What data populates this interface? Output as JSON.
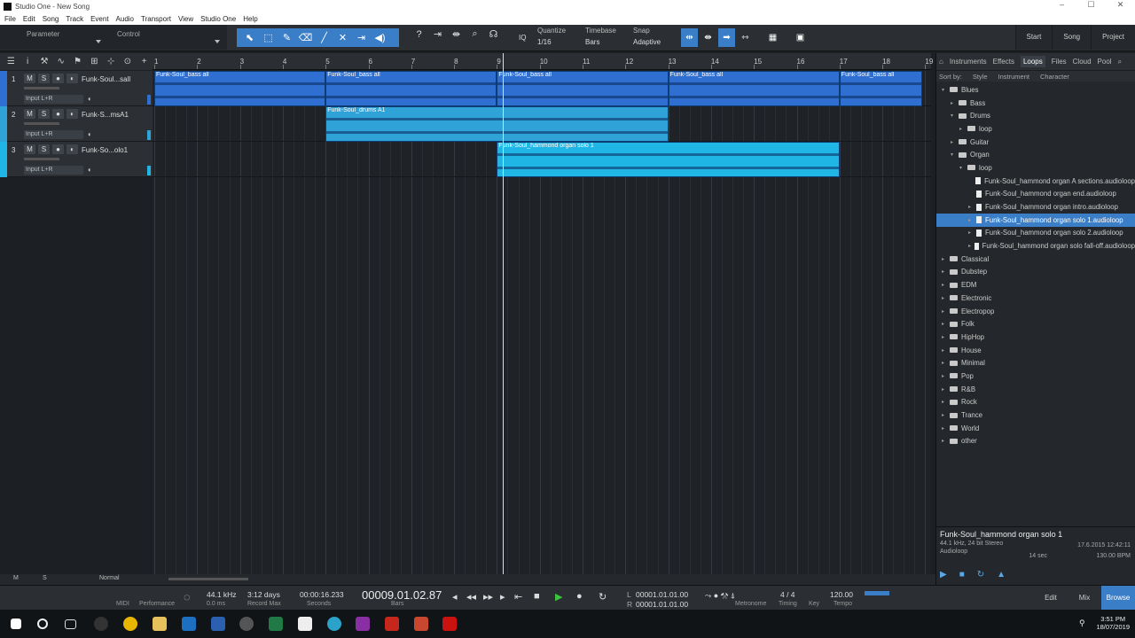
{
  "window": {
    "title": "Studio One - New Song",
    "controls": [
      "–",
      "☐",
      "✕"
    ]
  },
  "menu": [
    "File",
    "Edit",
    "Song",
    "Track",
    "Event",
    "Audio",
    "Transport",
    "View",
    "Studio One",
    "Help"
  ],
  "toolbar": {
    "parameter_label": "Parameter",
    "control_label": "Control",
    "quantize_label": "Quantize",
    "quantize_value": "1/16",
    "timebase_label": "Timebase",
    "timebase_value": "Bars",
    "snap_label": "Snap",
    "snap_value": "Adaptive",
    "iq_label": "IQ",
    "nav": [
      "Start",
      "Song",
      "Project"
    ]
  },
  "ruler": {
    "bars": [
      "1",
      "2",
      "3",
      "4",
      "5",
      "6",
      "7",
      "8",
      "9",
      "10",
      "11",
      "12",
      "13",
      "14",
      "15",
      "16",
      "17",
      "18",
      "19"
    ]
  },
  "tracks": [
    {
      "num": "1",
      "name": "Funk-Soul...sall",
      "input": "Input L+R",
      "color": "#2f6fd1"
    },
    {
      "num": "2",
      "name": "Funk-S...msA1",
      "input": "Input L+R",
      "color": "#2fa3d8"
    },
    {
      "num": "3",
      "name": "Funk-So...olo1",
      "input": "Input L+R",
      "color": "#1fb6e6"
    }
  ],
  "track_buttons": [
    "M",
    "S",
    "●",
    "◐"
  ],
  "clips": {
    "bass": "Funk-Soul_bass all",
    "drums": "Funk-Soul_drums A1",
    "organ": "Funk-Soul_hammond organ solo 1"
  },
  "browser": {
    "tabs": [
      "Instruments",
      "Effects",
      "Loops",
      "Files",
      "Cloud",
      "Pool"
    ],
    "active_tab": "Loops",
    "sort": {
      "label": "Sort by:",
      "cols": [
        "Style",
        "Instrument",
        "Character"
      ]
    },
    "tree": [
      {
        "label": "Blues",
        "depth": 0,
        "type": "folder",
        "open": true
      },
      {
        "label": "Bass",
        "depth": 1,
        "type": "folder"
      },
      {
        "label": "Drums",
        "depth": 1,
        "type": "folder",
        "open": true
      },
      {
        "label": "loop",
        "depth": 2,
        "type": "folder"
      },
      {
        "label": "Guitar",
        "depth": 1,
        "type": "folder"
      },
      {
        "label": "Organ",
        "depth": 1,
        "type": "folder",
        "open": true
      },
      {
        "label": "loop",
        "depth": 2,
        "type": "folder",
        "open": true
      },
      {
        "label": "Funk-Soul_hammond organ A sections.audioloop",
        "depth": 3,
        "type": "file"
      },
      {
        "label": "Funk-Soul_hammond organ end.audioloop",
        "depth": 3,
        "type": "file"
      },
      {
        "label": "Funk-Soul_hammond organ intro.audioloop",
        "depth": 3,
        "type": "file"
      },
      {
        "label": "Funk-Soul_hammond organ solo 1.audioloop",
        "depth": 3,
        "type": "file",
        "selected": true
      },
      {
        "label": "Funk-Soul_hammond organ solo 2.audioloop",
        "depth": 3,
        "type": "file"
      },
      {
        "label": "Funk-Soul_hammond organ solo fall-off.audioloop",
        "depth": 3,
        "type": "file"
      },
      {
        "label": "Classical",
        "depth": 0,
        "type": "folder"
      },
      {
        "label": "Dubstep",
        "depth": 0,
        "type": "folder"
      },
      {
        "label": "EDM",
        "depth": 0,
        "type": "folder"
      },
      {
        "label": "Electronic",
        "depth": 0,
        "type": "folder"
      },
      {
        "label": "Electropop",
        "depth": 0,
        "type": "folder"
      },
      {
        "label": "Folk",
        "depth": 0,
        "type": "folder"
      },
      {
        "label": "HipHop",
        "depth": 0,
        "type": "folder"
      },
      {
        "label": "House",
        "depth": 0,
        "type": "folder"
      },
      {
        "label": "Minimal",
        "depth": 0,
        "type": "folder"
      },
      {
        "label": "Pop",
        "depth": 0,
        "type": "folder"
      },
      {
        "label": "R&B",
        "depth": 0,
        "type": "folder"
      },
      {
        "label": "Rock",
        "depth": 0,
        "type": "folder"
      },
      {
        "label": "Trance",
        "depth": 0,
        "type": "folder"
      },
      {
        "label": "World",
        "depth": 0,
        "type": "folder"
      },
      {
        "label": "other",
        "depth": 0,
        "type": "folder"
      }
    ],
    "info": {
      "filename": "Funk-Soul_hammond organ solo 1",
      "format": "44.1 kHz, 24 bit Stereo",
      "date": "17.6.2015 12:42:11",
      "type": "Audioloop",
      "length": "14 sec",
      "bpm": "130.00 BPM"
    }
  },
  "bottom_strip": {
    "m": "M",
    "s": "S",
    "mode": "Normal"
  },
  "transport": {
    "midi_label": "MIDI",
    "performance_label": "Performance",
    "sample_rate": "44.1 kHz",
    "latency": "0.0 ms",
    "record_days": "3:12 days",
    "record_label": "Record Max",
    "seconds_value": "00:00:16.233",
    "seconds_label": "Seconds",
    "bars_value": "00009.01.02.87",
    "bars_label": "Bars",
    "loop_l": "00001.01.01.00",
    "loop_r": "00001.01.01.00",
    "l": "L",
    "r": "R",
    "metronome_label": "Metronome",
    "timing_value": "4 / 4",
    "timing_label": "Timing",
    "key_label": "Key",
    "tempo_value": "120.00",
    "tempo_label": "Tempo",
    "modes": [
      "Edit",
      "Mix",
      "Browse"
    ]
  },
  "taskbar": {
    "time": "3:51 PM",
    "date": "18/07/2019"
  }
}
